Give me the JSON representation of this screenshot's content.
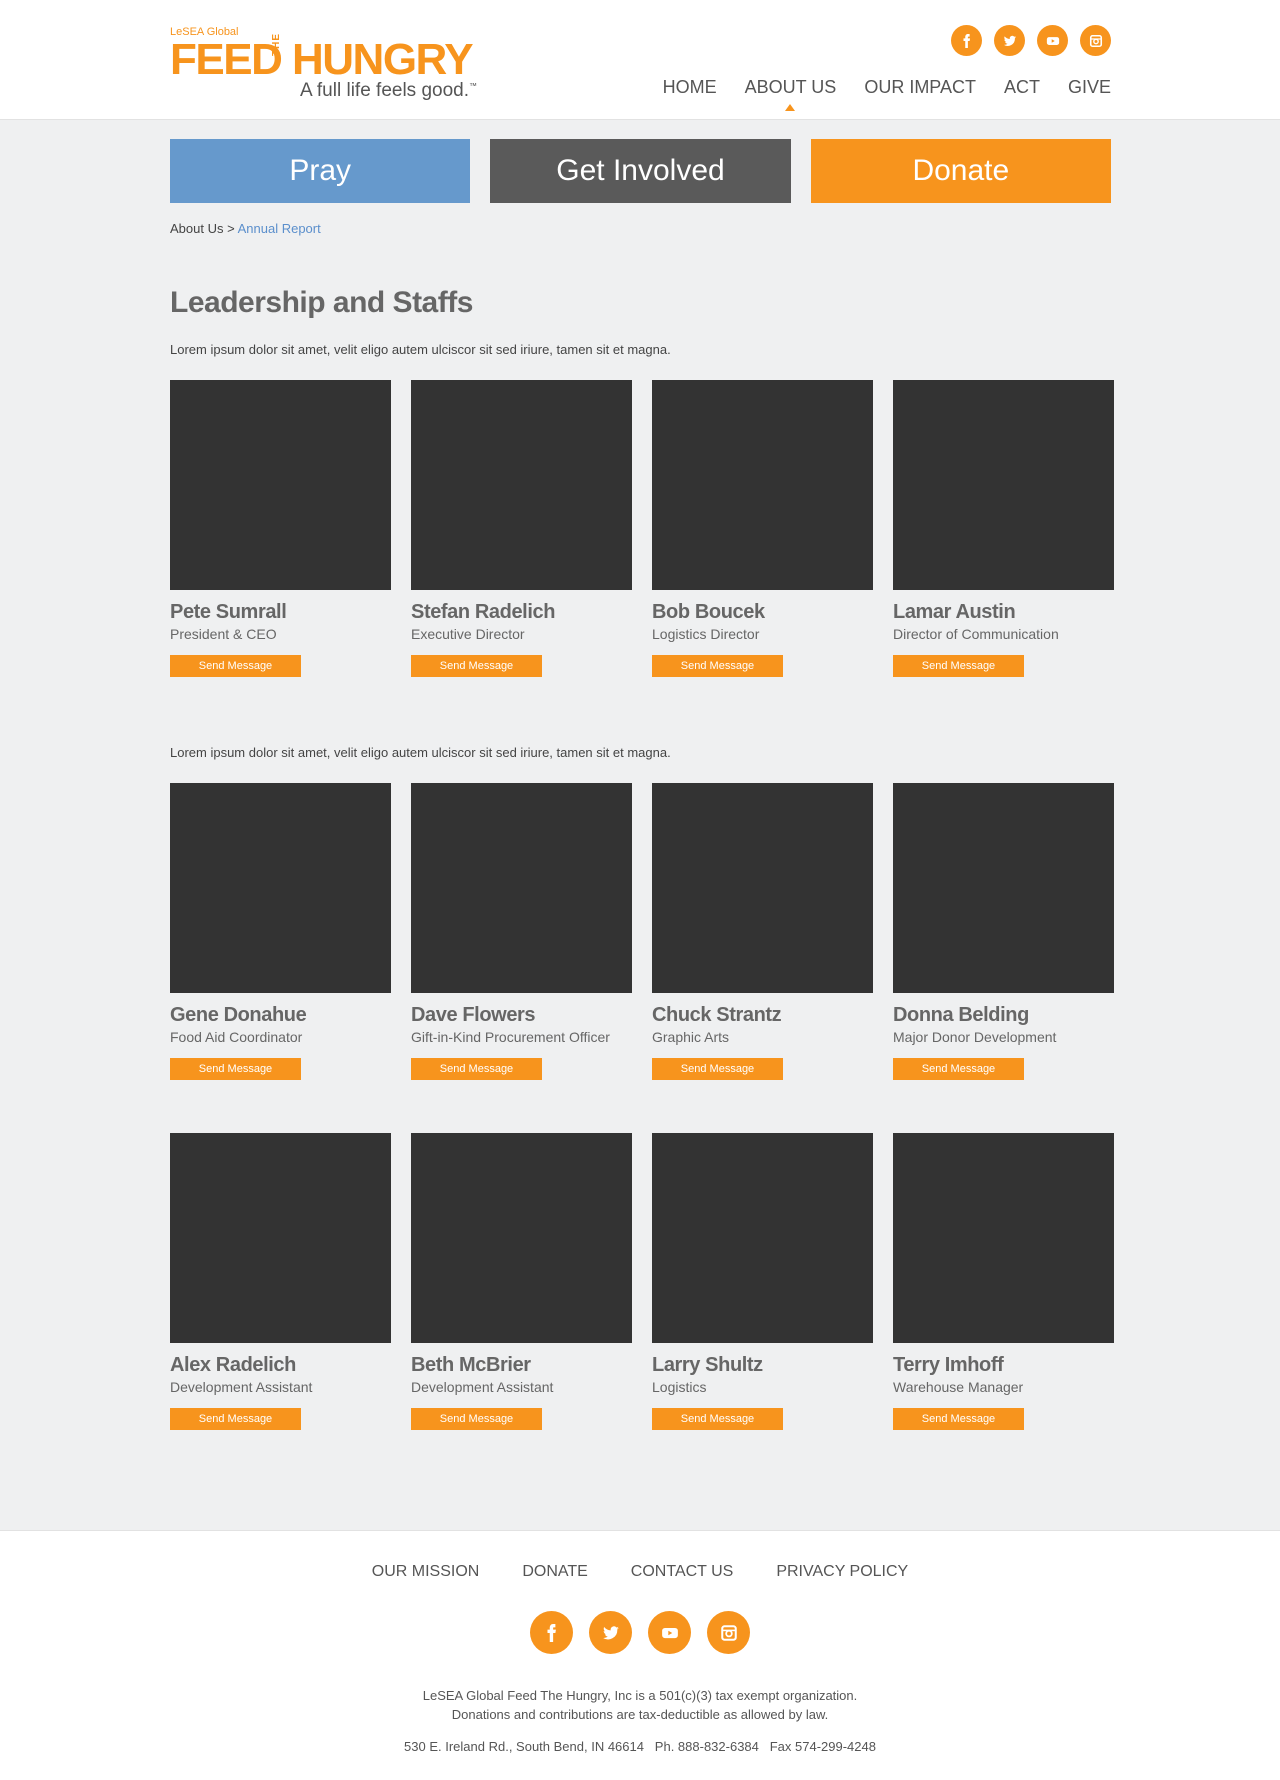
{
  "brand": {
    "top_label": "LeSEA Global",
    "feed": "FEED",
    "the": "THE",
    "hungry": "HUNGRY",
    "tagline": "A full life feels good.",
    "trademark": "™"
  },
  "colors": {
    "accent": "#f7941d",
    "blue": "#6699cc",
    "dark_button": "#5a5a5a",
    "photo": "#333333",
    "background": "#eff0f1"
  },
  "social": [
    {
      "icon": "facebook-icon",
      "glyph": "f"
    },
    {
      "icon": "twitter-icon",
      "glyph": "t"
    },
    {
      "icon": "youtube-icon",
      "glyph": "y"
    },
    {
      "icon": "instagram-icon",
      "glyph": "i"
    }
  ],
  "nav": {
    "home": "HOME",
    "about": "ABOUT US",
    "impact": "OUR IMPACT",
    "act": "ACT",
    "give": "GIVE"
  },
  "cta": {
    "pray": "Pray",
    "involved": "Get Involved",
    "donate": "Donate"
  },
  "breadcrumb": {
    "parent": "About Us",
    "separator": ">",
    "current": "Annual Report"
  },
  "section": {
    "title": "Leadership and Staffs",
    "intro_1": "Lorem ipsum dolor sit amet, velit eligo autem ulciscor sit sed iriure, tamen sit et magna.",
    "intro_2": "Lorem ipsum dolor sit amet, velit eligo autem ulciscor sit sed iriure, tamen sit et magna."
  },
  "send_label": "Send Message",
  "staff_rows": [
    [
      {
        "name": "Pete Sumrall",
        "role": "President & CEO"
      },
      {
        "name": "Stefan Radelich",
        "role": "Executive Director"
      },
      {
        "name": "Bob Boucek",
        "role": "Logistics Director"
      },
      {
        "name": "Lamar Austin",
        "role": "Director of Communication"
      }
    ],
    [
      {
        "name": "Gene Donahue",
        "role": "Food Aid Coordinator"
      },
      {
        "name": "Dave Flowers",
        "role": "Gift-in-Kind Procurement Officer"
      },
      {
        "name": "Chuck Strantz",
        "role": "Graphic Arts"
      },
      {
        "name": "Donna Belding",
        "role": "Major Donor Development"
      }
    ],
    [
      {
        "name": "Alex Radelich",
        "role": "Development Assistant"
      },
      {
        "name": "Beth McBrier",
        "role": "Development Assistant"
      },
      {
        "name": "Larry Shultz",
        "role": "Logistics"
      },
      {
        "name": "Terry Imhoff",
        "role": "Warehouse Manager"
      }
    ]
  ],
  "footer": {
    "links": {
      "mission": "OUR MISSION",
      "donate": "DONATE",
      "contact": "CONTACT US",
      "privacy": "PRIVACY POLICY"
    },
    "line1": "LeSEA Global Feed The Hungry, Inc is a 501(c)(3) tax exempt organization.",
    "line2": "Donations and contributions are tax-deductible as allowed by law.",
    "address": "530 E. Ireland Rd., South Bend, IN 46614   Ph. 888-832-6384   Fax 574-299-4248"
  }
}
